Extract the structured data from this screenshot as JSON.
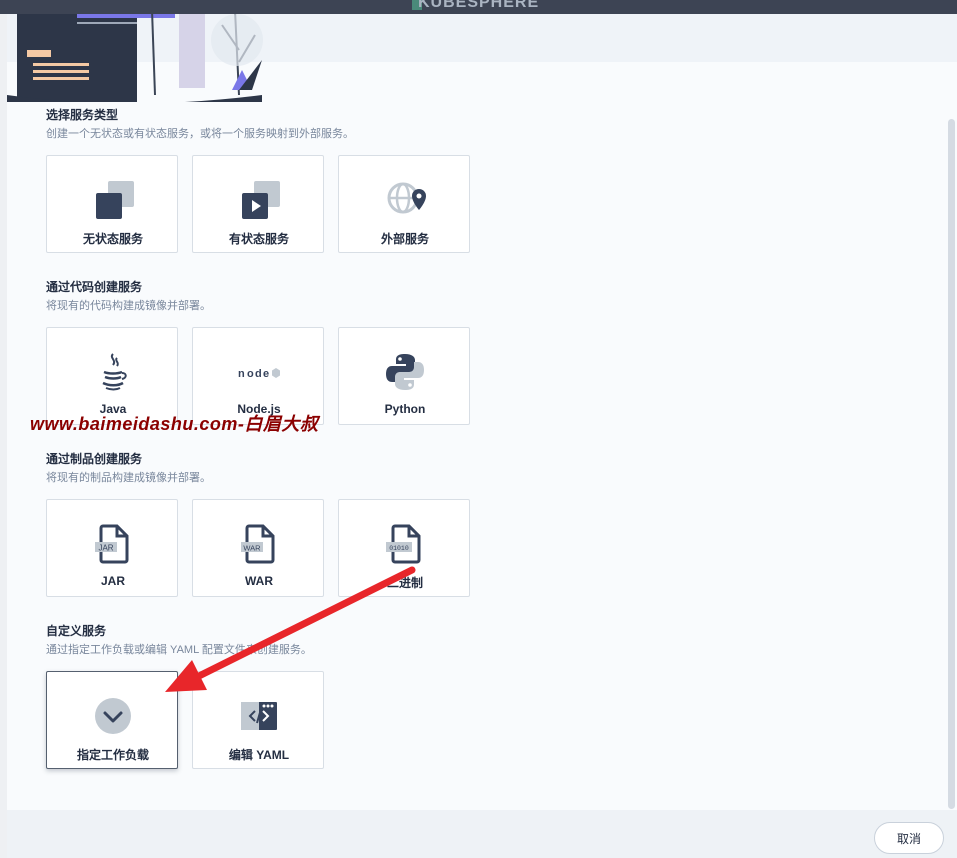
{
  "app": {
    "logo_text": "KUBESPHERE"
  },
  "sections": [
    {
      "title": "选择服务类型",
      "desc": "创建一个无状态或有状态服务，或将一个服务映射到外部服务。",
      "cards": [
        {
          "label": "无状态服务",
          "icon": "stateless-service-icon"
        },
        {
          "label": "有状态服务",
          "icon": "stateful-service-icon"
        },
        {
          "label": "外部服务",
          "icon": "external-service-icon"
        }
      ]
    },
    {
      "title": "通过代码创建服务",
      "desc": "将现有的代码构建成镜像并部署。",
      "cards": [
        {
          "label": "Java",
          "icon": "java-icon"
        },
        {
          "label": "Node.js",
          "icon": "nodejs-icon"
        },
        {
          "label": "Python",
          "icon": "python-icon"
        }
      ]
    },
    {
      "title": "通过制品创建服务",
      "desc": "将现有的制品构建成镜像并部署。",
      "cards": [
        {
          "label": "JAR",
          "icon": "jar-file-icon",
          "badge": "JAR"
        },
        {
          "label": "WAR",
          "icon": "war-file-icon",
          "badge": "WAR"
        },
        {
          "label": "二进制",
          "icon": "binary-file-icon",
          "badge": "01010"
        }
      ]
    },
    {
      "title": "自定义服务",
      "desc": "通过指定工作负载或编辑 YAML 配置文件来创建服务。",
      "cards": [
        {
          "label": "指定工作负载",
          "icon": "workload-chevron-icon",
          "selected": true
        },
        {
          "label": "编辑 YAML",
          "icon": "code-yaml-icon"
        }
      ]
    }
  ],
  "watermark": "www.baimeidashu.com-白眉大叔",
  "footer": {
    "cancel_label": "取消"
  },
  "colors": {
    "icon_dark": "#36435c",
    "icon_light": "#c1c9d1",
    "arrow_red": "#e8262a"
  }
}
